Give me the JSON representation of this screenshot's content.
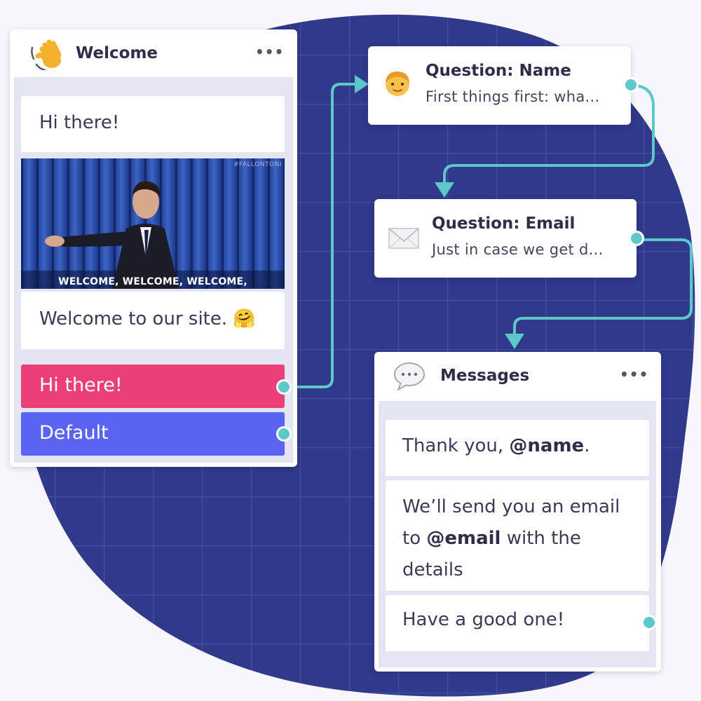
{
  "welcome_block": {
    "title": "Welcome",
    "more_label": "•••",
    "icon": "waving-hand-icon",
    "messages": {
      "greeting": "Hi there!",
      "gif_caption": "WELCOME, WELCOME, WELCOME,",
      "gif_watermark": "#FALLONTONI",
      "text": "Welcome to our site. 🤗"
    },
    "options": [
      {
        "label": "Hi there!",
        "color": "#ea3f77"
      },
      {
        "label": "Default",
        "color": "#5a63f2"
      }
    ]
  },
  "question_name": {
    "icon": "person-icon",
    "title": "Question: Name",
    "preview": "First things first: wha..."
  },
  "question_email": {
    "icon": "envelope-icon",
    "title": "Question: Email",
    "preview": "Just in case we get d..."
  },
  "messages_block": {
    "icon": "speech-bubble-icon",
    "title": "Messages",
    "more_label": "•••",
    "messages": [
      {
        "pre": "Thank you, ",
        "var": "@name",
        "post": "."
      },
      {
        "pre": "We’ll send you an email to ",
        "var": "@email",
        "post": " with the details"
      },
      {
        "text": "Have a good one!"
      }
    ]
  },
  "colors": {
    "blob": "#30398a",
    "connector": "#5cc8c8",
    "page_bg": "#f6f6fc",
    "option_pink": "#ea3f77",
    "option_blue": "#5a63f2"
  }
}
